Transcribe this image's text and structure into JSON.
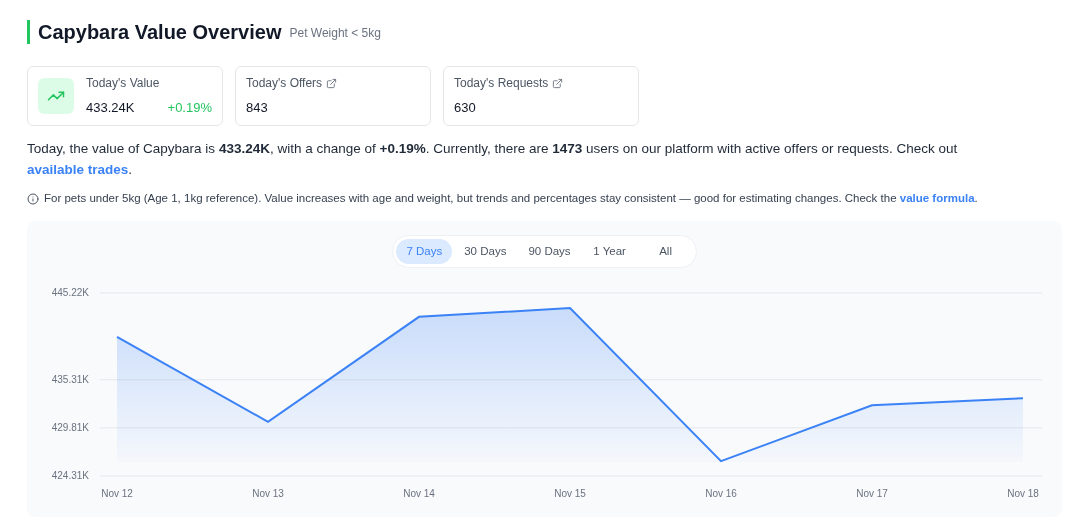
{
  "header": {
    "title": "Capybara Value Overview",
    "subtitle": "Pet Weight < 5kg"
  },
  "stats": [
    {
      "kind": "value",
      "label": "Today's Value",
      "value": "433.24K",
      "change": "+0.19%"
    },
    {
      "kind": "link",
      "label": "Today's Offers",
      "value": "843"
    },
    {
      "kind": "link",
      "label": "Today's Requests",
      "value": "630"
    }
  ],
  "summary": {
    "text": "Today, the value of Capybara is **433.24K**, with a change of **+0.19%**. Currently, there are **1473** users on our platform with active offers or requests. Check out",
    "link": "available trades",
    "end": "."
  },
  "note": {
    "text": "For pets under 5kg (Age 1, 1kg reference). Value increases with age and weight, but trends and percentages stay consistent — good for estimating changes. Check the",
    "link": "value formula",
    "end": "."
  },
  "ranges": [
    {
      "label": "7 Days",
      "selected": true
    },
    {
      "label": "30 Days",
      "selected": false
    },
    {
      "label": "90 Days",
      "selected": false
    },
    {
      "label": "1 Year",
      "selected": false
    },
    {
      "label": "All",
      "selected": false
    }
  ],
  "chart": {
    "chart_data": {
      "type": "area",
      "categories": [
        "Nov 12",
        "Nov 13",
        "Nov 14",
        "Nov 15",
        "Nov 16",
        "Nov 17",
        "Nov 18"
      ],
      "series": [
        {
          "color": "#3b82f6",
          "values": [
            440.2,
            430.5,
            442.5,
            443.5,
            426.0,
            432.4,
            433.2
          ]
        }
      ],
      "ylim": [
        424.31,
        445.22
      ],
      "yticks": [
        {
          "value": 445.22,
          "label": "445.22K"
        },
        {
          "value": 435.31,
          "label": "435.31K"
        },
        {
          "value": 429.81,
          "label": "429.81K"
        },
        {
          "value": 424.31,
          "label": "424.31K"
        }
      ]
    }
  }
}
